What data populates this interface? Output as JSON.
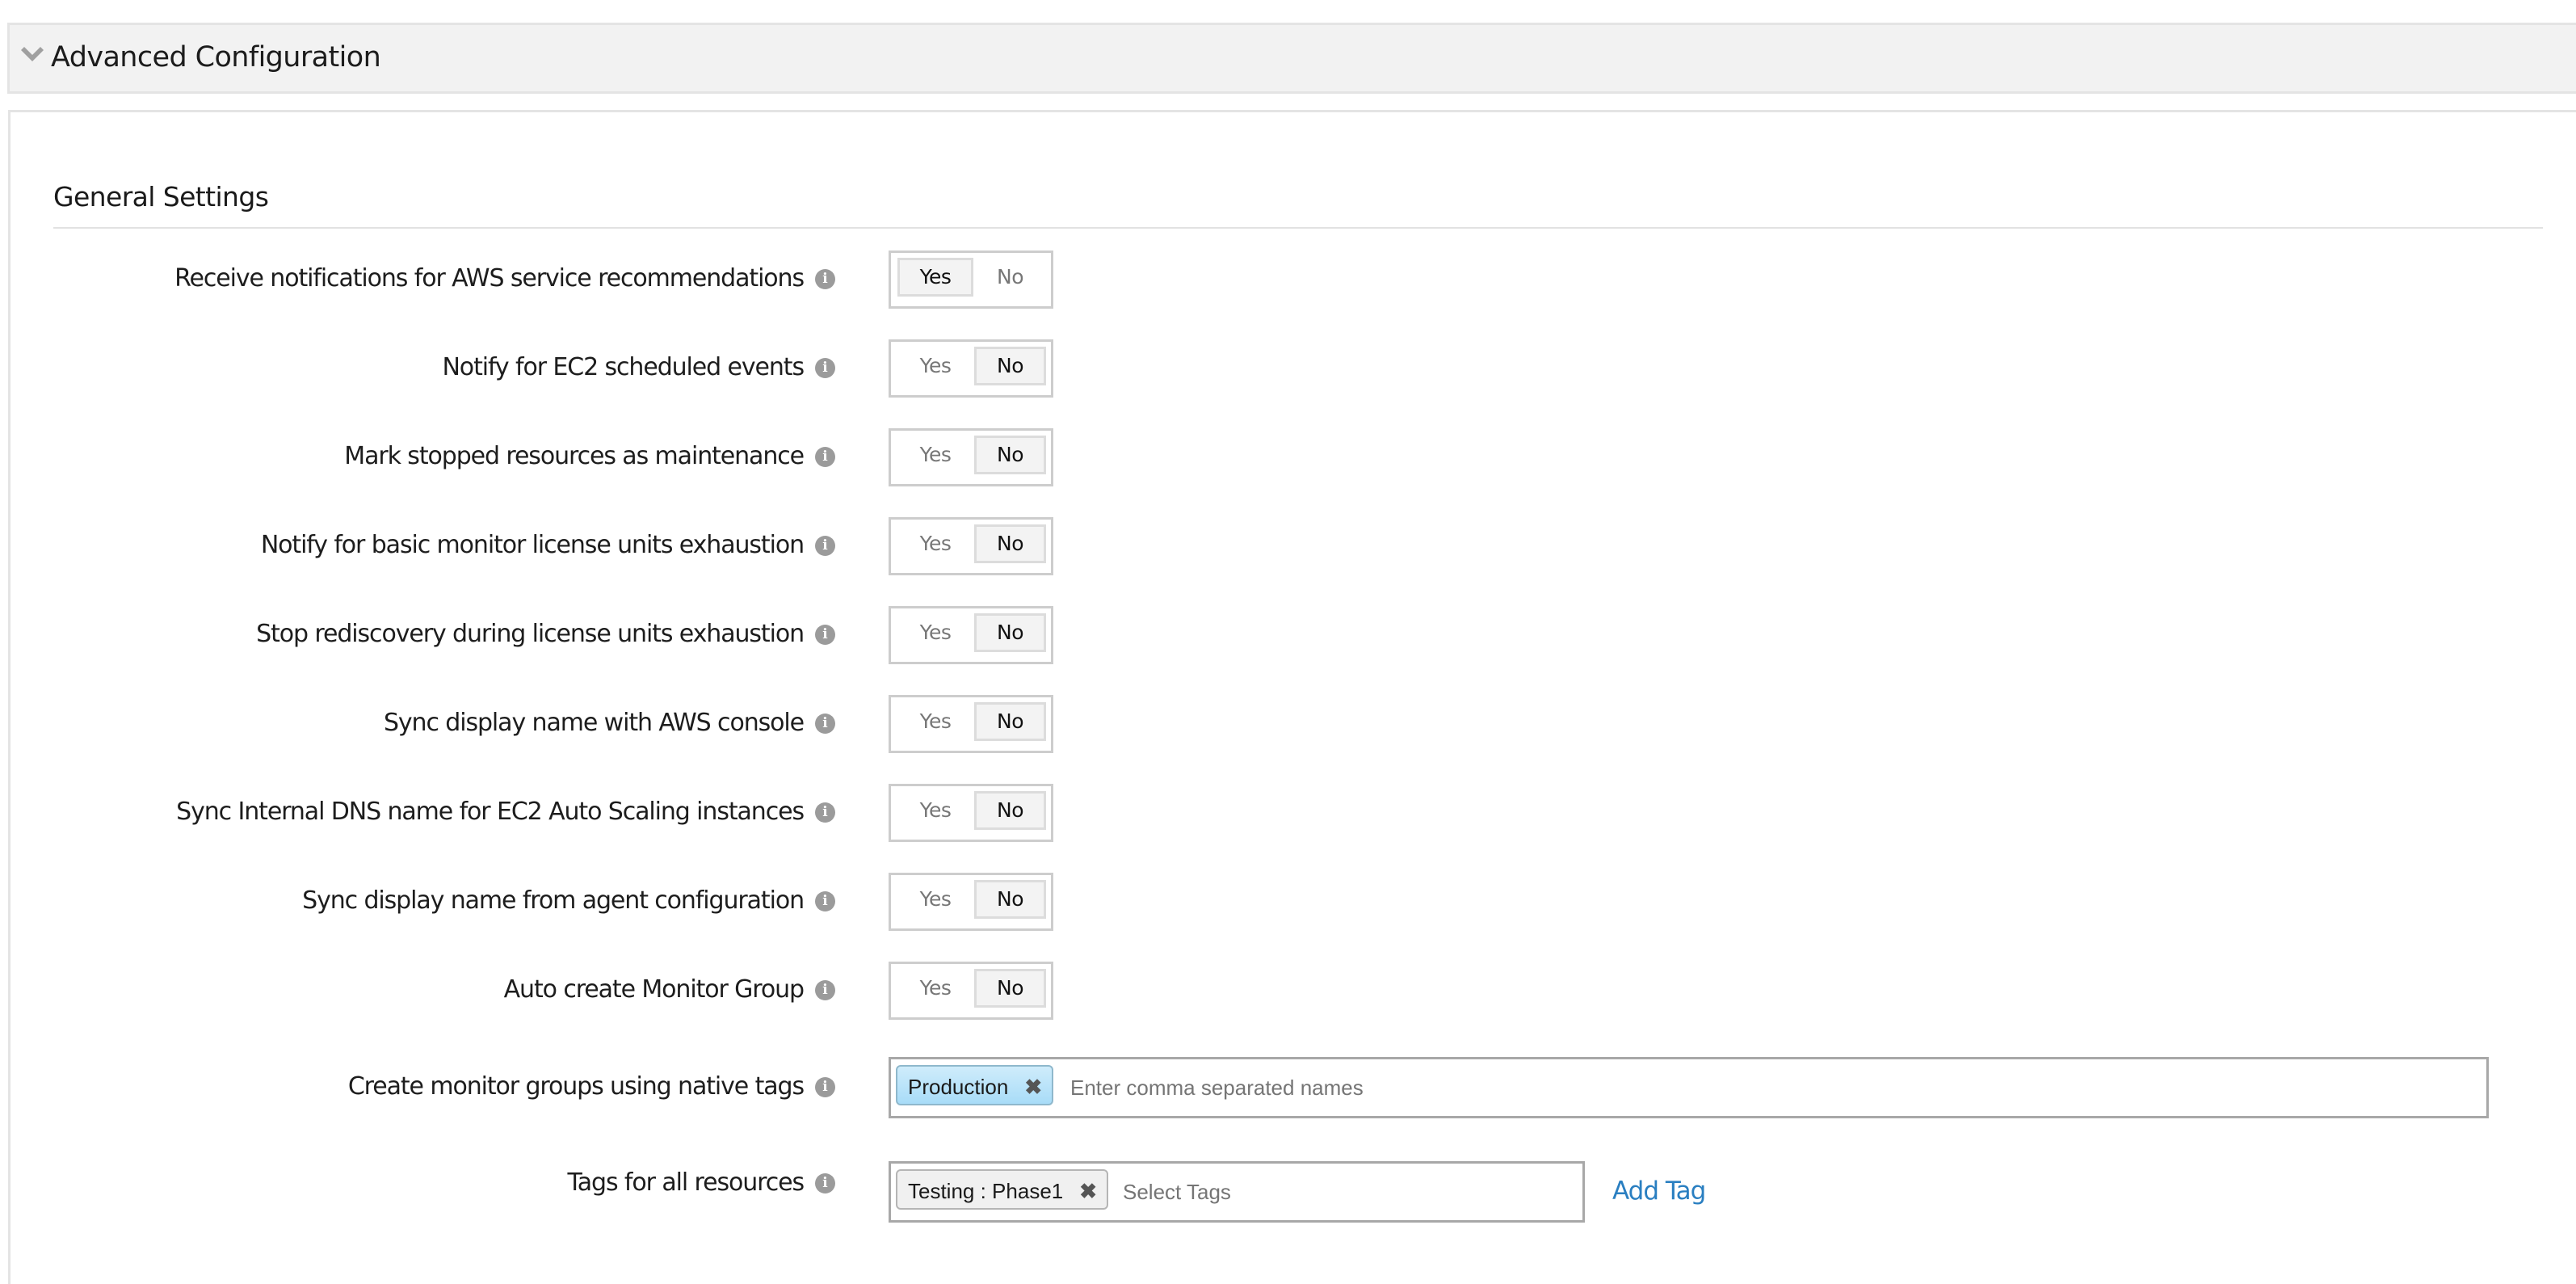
{
  "header": {
    "title": "Advanced Configuration",
    "expand_icon": "chevron-down-icon"
  },
  "section": {
    "title": "General Settings"
  },
  "toggle_options": {
    "yes": "Yes",
    "no": "No"
  },
  "settings": [
    {
      "label": "Receive notifications for AWS service recommendations",
      "value": "Yes"
    },
    {
      "label": "Notify for EC2 scheduled events",
      "value": "No"
    },
    {
      "label": "Mark stopped resources as maintenance",
      "value": "No"
    },
    {
      "label": "Notify for basic monitor license units exhaustion",
      "value": "No"
    },
    {
      "label": "Stop rediscovery during license units exhaustion",
      "value": "No"
    },
    {
      "label": "Sync display name with AWS console",
      "value": "No"
    },
    {
      "label": "Sync Internal DNS name for EC2 Auto Scaling instances",
      "value": "No"
    },
    {
      "label": "Sync display name from agent configuration",
      "value": "No"
    },
    {
      "label": "Auto create Monitor Group",
      "value": "No"
    }
  ],
  "native_tags": {
    "label": "Create monitor groups using native tags",
    "tags": [
      "Production"
    ],
    "placeholder": "Enter comma separated names"
  },
  "resource_tags": {
    "label": "Tags for all resources",
    "tags": [
      "Testing : Phase1"
    ],
    "placeholder": "Select Tags",
    "add_label": "Add Tag"
  },
  "icons": {
    "info": "info-icon",
    "remove": "close-icon"
  },
  "colors": {
    "link": "#2a7fc1",
    "selected_tag": "#a8dcf8",
    "header_bg": "#f2f2f2"
  }
}
